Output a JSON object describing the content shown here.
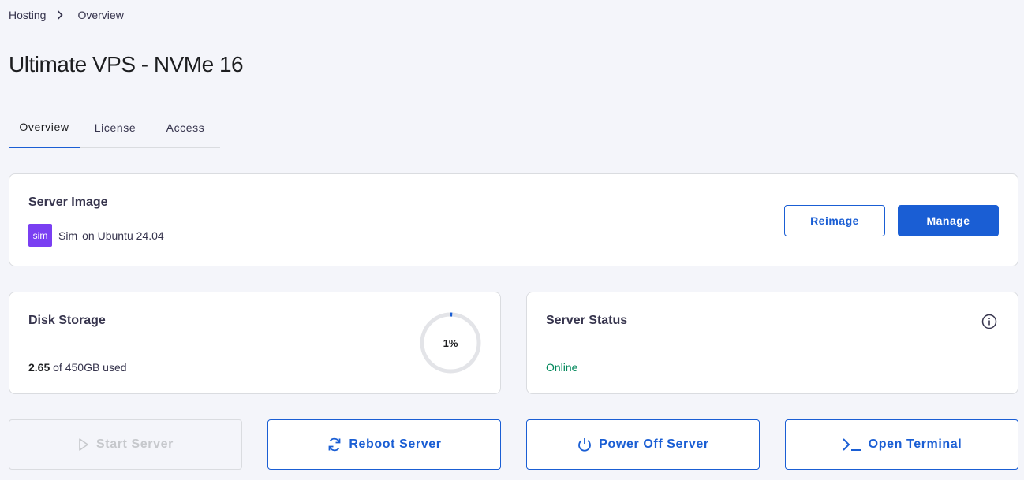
{
  "breadcrumb": {
    "items": [
      "Hosting",
      "Overview"
    ]
  },
  "page": {
    "title": "Ultimate VPS - NVMe 16"
  },
  "tabs": [
    {
      "label": "Overview",
      "active": true
    },
    {
      "label": "License",
      "active": false
    },
    {
      "label": "Access",
      "active": false
    }
  ],
  "server_image": {
    "title": "Server Image",
    "os_logo": "sim",
    "os_name": "Sim",
    "os_on": "on Ubuntu 24.04",
    "reimage_label": "Reimage",
    "manage_label": "Manage"
  },
  "disk_storage": {
    "title": "Disk Storage",
    "used": "2.65",
    "of_text": "of 450GB used",
    "percent_label": "1%",
    "percent": 0.01
  },
  "server_status": {
    "title": "Server Status",
    "status": "Online",
    "status_color": "#00875a"
  },
  "actions": [
    {
      "label": "Start Server",
      "icon": "play-icon",
      "disabled": true
    },
    {
      "label": "Reboot Server",
      "icon": "refresh-icon",
      "disabled": false
    },
    {
      "label": "Power Off Server",
      "icon": "power-icon",
      "disabled": false
    },
    {
      "label": "Open Terminal",
      "icon": "terminal-icon",
      "disabled": false
    }
  ],
  "colors": {
    "primary": "#1a5ed4",
    "background": "#f4f5fa",
    "os_logo": "#7a3ff2"
  }
}
